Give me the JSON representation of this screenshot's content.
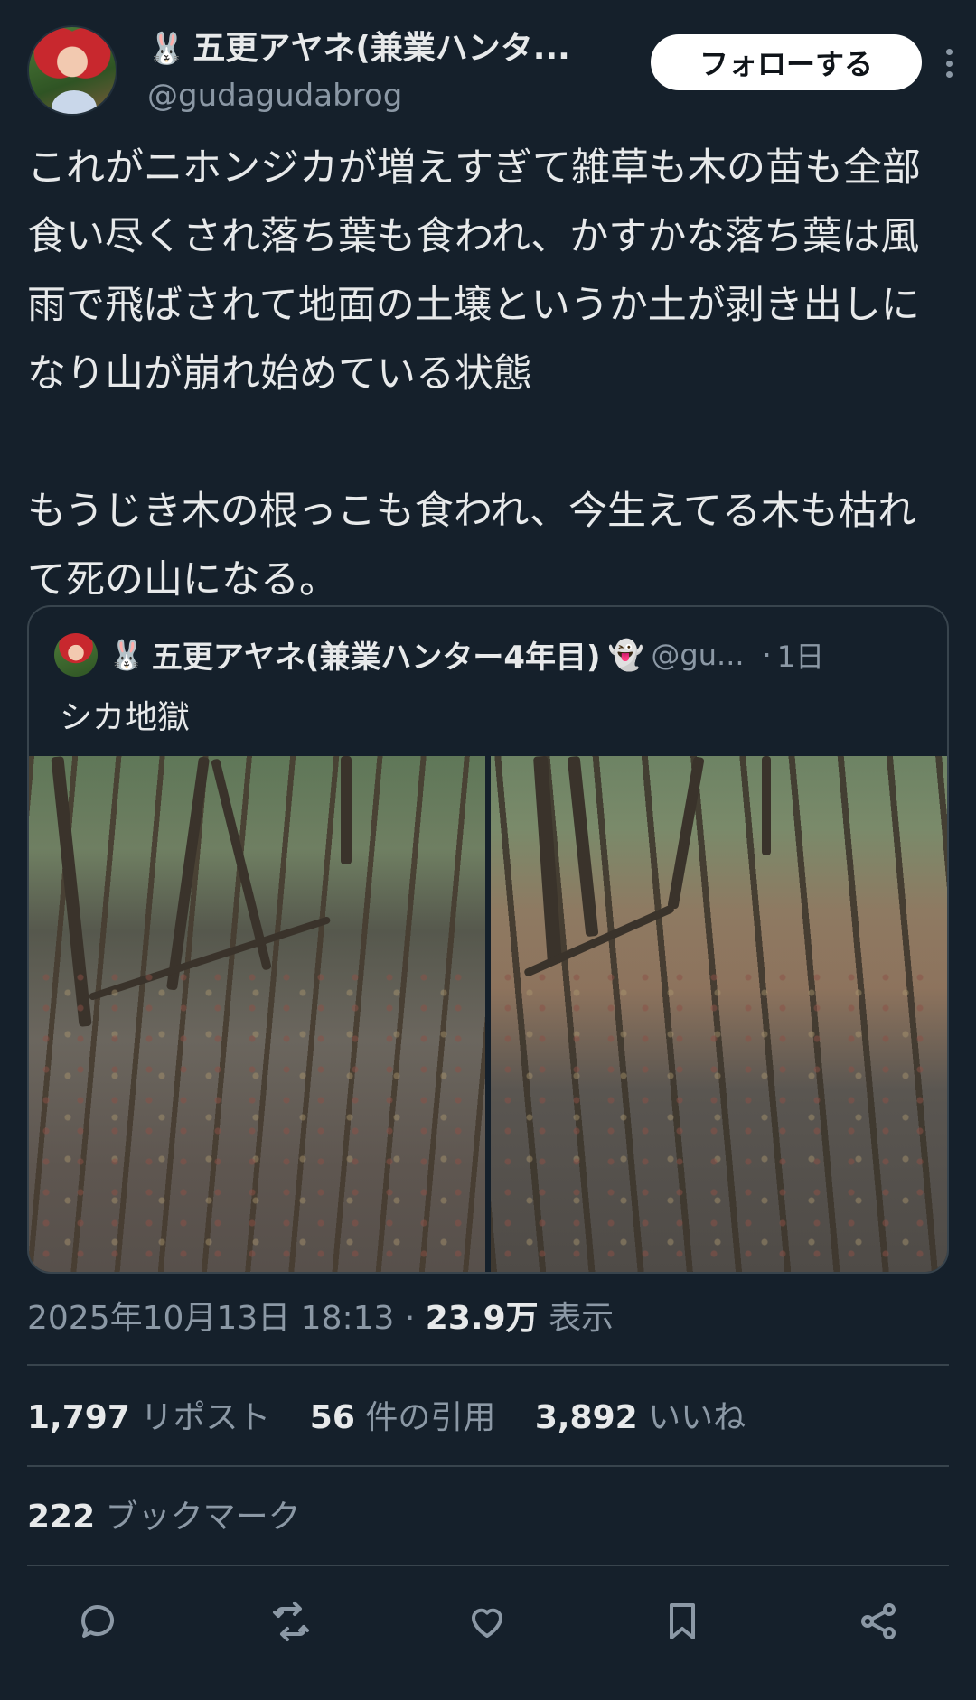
{
  "author": {
    "display_name": "五更アヤネ(兼業ハンタ...",
    "handle": "@gudagudabrog",
    "avatar_icon": "user-avatar",
    "prefix_icon": "🐰"
  },
  "follow_button": {
    "label": "フォローする"
  },
  "tweet": {
    "paragraph1": "これがニホンジカが増えすぎて雑草も木の苗も全部食い尽くされ落ち葉も食われ、かすかな落ち葉は風雨で飛ばされて地面の土壌というか土が剥き出しになり山が崩れ始めている状態",
    "paragraph2": "もうじき木の根っこも食われ、今生えてる木も枯れて死の山になる。"
  },
  "quote": {
    "prefix_icon": "🐰",
    "display_name": "五更アヤネ(兼業ハンター4年目)",
    "ghost_icon": "👻",
    "handle": "@gu...",
    "dot": "·",
    "time": "1日",
    "text": "シカ地獄"
  },
  "meta": {
    "timestamp": "2025年10月13日 18:13",
    "separator": "·",
    "views": "23.9万",
    "views_label": "表示"
  },
  "stats": {
    "reposts_count": "1,797",
    "reposts_label": "リポスト",
    "quotes_count": "56",
    "quotes_label": "件の引用",
    "likes_count": "3,892",
    "likes_label": "いいね",
    "bookmarks_count": "222",
    "bookmarks_label": "ブックマーク"
  },
  "actions": [
    "reply-icon",
    "retweet-icon",
    "like-icon",
    "bookmark-icon",
    "share-icon"
  ],
  "colors": {
    "background": "#15202b",
    "text": "#e7e9ea",
    "muted": "#8b98a5",
    "border": "#38444d"
  }
}
